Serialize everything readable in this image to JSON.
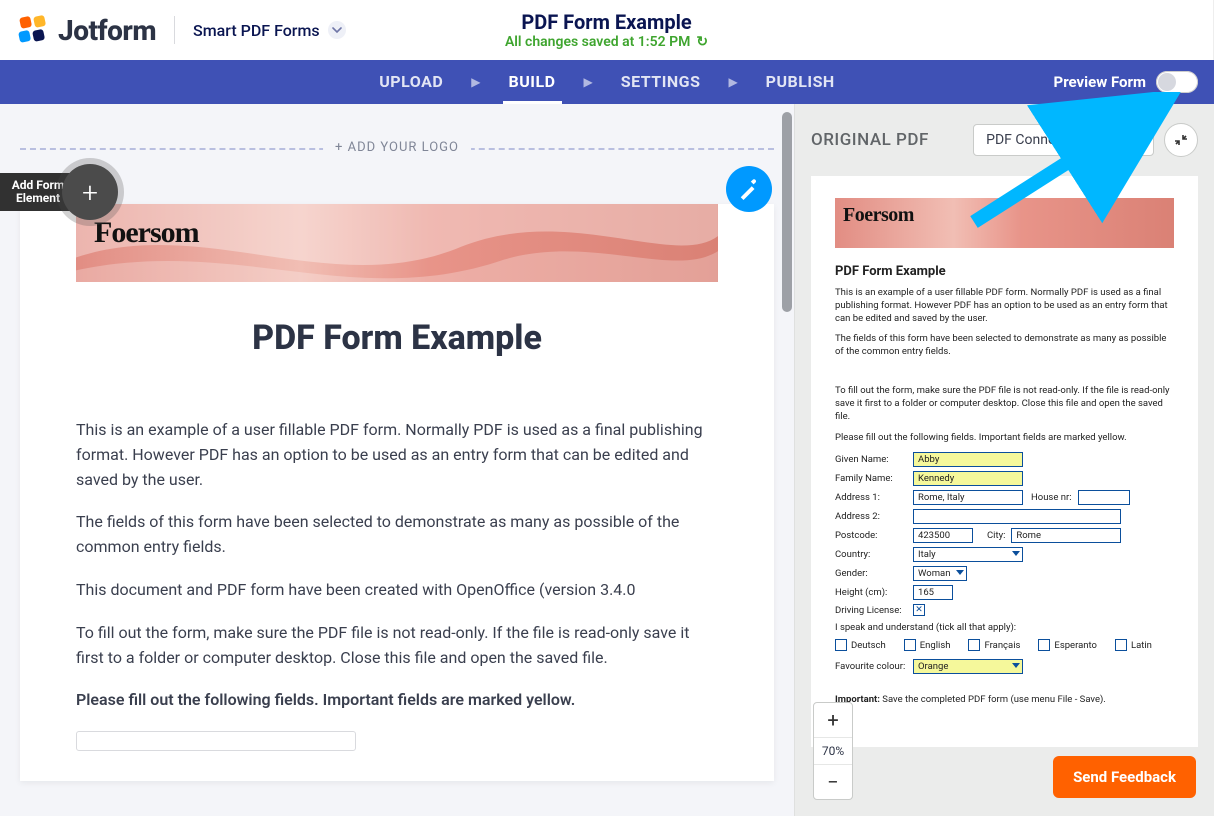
{
  "header": {
    "logo_text": "Jotform",
    "product": "Smart PDF Forms",
    "title": "PDF Form Example",
    "save_status": "All changes saved at 1:52 PM",
    "reload_icon": "↻"
  },
  "nav": {
    "upload": "UPLOAD",
    "build": "BUILD",
    "settings": "SETTINGS",
    "publish": "PUBLISH",
    "preview_label": "Preview Form"
  },
  "builder": {
    "add_logo": "+ ADD YOUR LOGO",
    "add_element": "Add Form Element",
    "banner_brand": "Foersom",
    "form_title": "PDF Form Example",
    "p1": "This is an example of a user fillable PDF form. Normally PDF is used as a final publishing format. However PDF has an option to be used as an entry form that can be edited and saved by the user.",
    "p2": "The fields of this form have been selected to demonstrate as many as possible of the common entry fields.",
    "p3": "This document and PDF form have been created with OpenOffice (version 3.4.0",
    "p4": "To fill out the form, make sure the PDF file is not read-only. If the file is read-only save it first to a folder or computer desktop. Close this file and open the saved file.",
    "sub": "Please fill out the following fields. Important fields are marked yellow."
  },
  "panel": {
    "title": "ORIGINAL PDF",
    "settings_btn": "PDF Connection Settings",
    "zoom_level": "70%",
    "feedback": "Send Feedback",
    "pdf": {
      "brand": "Foersom",
      "h": "PDF Form Example",
      "p1": "This is an example of a user fillable PDF form. Normally PDF is used as a final publishing format. However PDF has an option to be used as an entry form that can be edited and saved by the user.",
      "p2": "The fields of this form have been selected to demonstrate as many as possible of the common entry fields.",
      "p3": "To fill out the form, make sure the PDF file is not read-only. If the file is read-only save it first to a folder or computer desktop. Close this file and open the saved file.",
      "p4": "Please fill out the following fields. Important fields are marked yellow.",
      "given_name_l": "Given Name:",
      "given_name_v": "Abby",
      "family_name_l": "Family Name:",
      "family_name_v": "Kennedy",
      "address1_l": "Address 1:",
      "address1_v": "Rome, Italy",
      "house_l": "House nr:",
      "address2_l": "Address 2:",
      "postcode_l": "Postcode:",
      "postcode_v": "423500",
      "city_l": "City:",
      "city_v": "Rome",
      "country_l": "Country:",
      "country_v": "Italy",
      "gender_l": "Gender:",
      "gender_v": "Woman",
      "height_l": "Height (cm):",
      "height_v": "165",
      "driving_l": "Driving License:",
      "lang_l": "I speak and understand (tick all that apply):",
      "lang1": "Deutsch",
      "lang2": "English",
      "lang3": "Français",
      "lang4": "Esperanto",
      "lang5": "Latin",
      "fav_l": "Favourite colour:",
      "fav_v": "Orange",
      "important_l": "Important:",
      "important_t": " Save the completed PDF form (use menu File - Save)."
    }
  }
}
